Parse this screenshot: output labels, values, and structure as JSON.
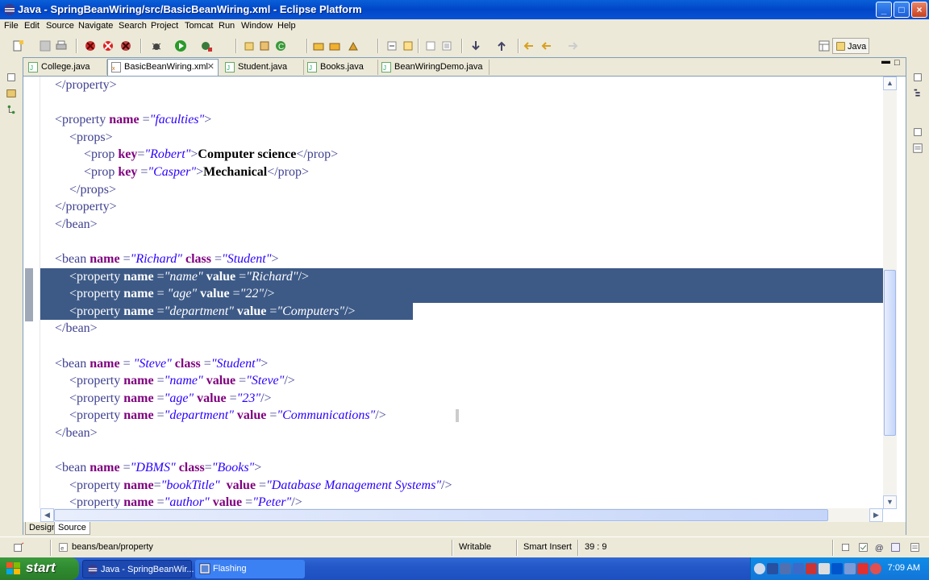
{
  "window": {
    "title": "Java - SpringBeanWiring/src/BasicBeanWiring.xml - Eclipse Platform",
    "controls": {
      "minimize": "_",
      "maximize": "□",
      "close": "×"
    }
  },
  "menu": [
    "File",
    "Edit",
    "Source",
    "Navigate",
    "Search",
    "Project",
    "Tomcat",
    "Run",
    "Window",
    "Help"
  ],
  "perspective": {
    "label": "Java"
  },
  "tabs": [
    {
      "label": "College.java",
      "active": false
    },
    {
      "label": "BasicBeanWiring.xml",
      "active": true
    },
    {
      "label": "Student.java",
      "active": false
    },
    {
      "label": "Books.java",
      "active": false
    },
    {
      "label": "BeanWiringDemo.java",
      "active": false
    }
  ],
  "code_lines": [
    {
      "indent": 1,
      "selected": false,
      "tokens": [
        [
          "tag",
          "</property>"
        ]
      ]
    },
    {
      "indent": 0,
      "selected": false,
      "tokens": []
    },
    {
      "indent": 1,
      "selected": false,
      "tokens": [
        [
          "tag",
          "<property "
        ],
        [
          "attr",
          "name "
        ],
        [
          "tag",
          "="
        ],
        [
          "val",
          "\"faculties\""
        ],
        [
          "tag",
          ">"
        ]
      ]
    },
    {
      "indent": 2,
      "selected": false,
      "tokens": [
        [
          "tag",
          "<props>"
        ]
      ]
    },
    {
      "indent": 3,
      "selected": false,
      "tokens": [
        [
          "tag",
          "<prop "
        ],
        [
          "attr",
          "key"
        ],
        [
          "tag",
          "="
        ],
        [
          "val",
          "\"Robert\""
        ],
        [
          "tag",
          ">"
        ],
        [
          "txt",
          "Computer science"
        ],
        [
          "tag",
          "</prop>"
        ]
      ]
    },
    {
      "indent": 3,
      "selected": false,
      "tokens": [
        [
          "tag",
          "<prop "
        ],
        [
          "attr",
          "key "
        ],
        [
          "tag",
          "="
        ],
        [
          "val",
          "\"Casper\""
        ],
        [
          "tag",
          ">"
        ],
        [
          "txt",
          "Mechanical"
        ],
        [
          "tag",
          "</prop>"
        ]
      ]
    },
    {
      "indent": 2,
      "selected": false,
      "tokens": [
        [
          "tag",
          "</props>"
        ]
      ]
    },
    {
      "indent": 1,
      "selected": false,
      "tokens": [
        [
          "tag",
          "</property>"
        ]
      ]
    },
    {
      "indent": 1,
      "selected": false,
      "tokens": [
        [
          "tag",
          "</bean>"
        ]
      ]
    },
    {
      "indent": 0,
      "selected": false,
      "tokens": []
    },
    {
      "indent": 1,
      "selected": false,
      "tokens": [
        [
          "tag",
          "<bean "
        ],
        [
          "attr",
          "name "
        ],
        [
          "tag",
          "="
        ],
        [
          "val",
          "\"Richard\""
        ],
        [
          "tag",
          " "
        ],
        [
          "attr",
          "class "
        ],
        [
          "tag",
          "="
        ],
        [
          "val",
          "\"Student\""
        ],
        [
          "tag",
          ">"
        ]
      ]
    },
    {
      "indent": 2,
      "selected": true,
      "tokens": [
        [
          "tag",
          "<property "
        ],
        [
          "attr",
          "name "
        ],
        [
          "tag",
          "="
        ],
        [
          "val",
          "\"name\""
        ],
        [
          "tag",
          " "
        ],
        [
          "attr",
          "value "
        ],
        [
          "tag",
          "="
        ],
        [
          "val",
          "\"Richard\""
        ],
        [
          "tag",
          "/>"
        ]
      ]
    },
    {
      "indent": 2,
      "selected": true,
      "tokens": [
        [
          "tag",
          "<property "
        ],
        [
          "attr",
          "name "
        ],
        [
          "tag",
          "= "
        ],
        [
          "val",
          "\"age\""
        ],
        [
          "tag",
          " "
        ],
        [
          "attr",
          "value "
        ],
        [
          "tag",
          "="
        ],
        [
          "val",
          "\"22\""
        ],
        [
          "tag",
          "/>"
        ]
      ]
    },
    {
      "indent": 2,
      "selected": true,
      "tokens": [
        [
          "tag",
          "<property "
        ],
        [
          "attr",
          "name "
        ],
        [
          "tag",
          "="
        ],
        [
          "val",
          "\"department\""
        ],
        [
          "tag",
          " "
        ],
        [
          "attr",
          "value "
        ],
        [
          "tag",
          "="
        ],
        [
          "val",
          "\"Computers\""
        ],
        [
          "tag",
          "/>"
        ]
      ]
    },
    {
      "indent": 1,
      "selected": false,
      "tokens": [
        [
          "tag",
          "</bean>"
        ]
      ]
    },
    {
      "indent": 0,
      "selected": false,
      "tokens": []
    },
    {
      "indent": 1,
      "selected": false,
      "tokens": [
        [
          "tag",
          "<bean "
        ],
        [
          "attr",
          "name "
        ],
        [
          "tag",
          "= "
        ],
        [
          "val",
          "\"Steve\""
        ],
        [
          "tag",
          " "
        ],
        [
          "attr",
          "class "
        ],
        [
          "tag",
          "="
        ],
        [
          "val",
          "\"Student\""
        ],
        [
          "tag",
          ">"
        ]
      ]
    },
    {
      "indent": 2,
      "selected": false,
      "tokens": [
        [
          "tag",
          "<property "
        ],
        [
          "attr",
          "name "
        ],
        [
          "tag",
          "="
        ],
        [
          "val",
          "\"name\""
        ],
        [
          "tag",
          " "
        ],
        [
          "attr",
          "value "
        ],
        [
          "tag",
          "="
        ],
        [
          "val",
          "\"Steve\""
        ],
        [
          "tag",
          "/>"
        ]
      ]
    },
    {
      "indent": 2,
      "selected": false,
      "tokens": [
        [
          "tag",
          "<property "
        ],
        [
          "attr",
          "name "
        ],
        [
          "tag",
          "="
        ],
        [
          "val",
          "\"age\""
        ],
        [
          "tag",
          " "
        ],
        [
          "attr",
          "value "
        ],
        [
          "tag",
          "="
        ],
        [
          "val",
          "\"23\""
        ],
        [
          "tag",
          "/>"
        ]
      ]
    },
    {
      "indent": 2,
      "selected": false,
      "tokens": [
        [
          "tag",
          "<property "
        ],
        [
          "attr",
          "name "
        ],
        [
          "tag",
          "="
        ],
        [
          "val",
          "\"department\""
        ],
        [
          "tag",
          " "
        ],
        [
          "attr",
          "value "
        ],
        [
          "tag",
          "="
        ],
        [
          "val",
          "\"Communications\""
        ],
        [
          "tag",
          "/>"
        ]
      ]
    },
    {
      "indent": 1,
      "selected": false,
      "tokens": [
        [
          "tag",
          "</bean>"
        ]
      ]
    },
    {
      "indent": 0,
      "selected": false,
      "tokens": []
    },
    {
      "indent": 1,
      "selected": false,
      "tokens": [
        [
          "tag",
          "<bean "
        ],
        [
          "attr",
          "name "
        ],
        [
          "tag",
          "="
        ],
        [
          "val",
          "\"DBMS\""
        ],
        [
          "tag",
          " "
        ],
        [
          "attr",
          "class"
        ],
        [
          "tag",
          "="
        ],
        [
          "val",
          "\"Books\""
        ],
        [
          "tag",
          ">"
        ]
      ]
    },
    {
      "indent": 2,
      "selected": false,
      "tokens": [
        [
          "tag",
          "<property "
        ],
        [
          "attr",
          "name"
        ],
        [
          "tag",
          "="
        ],
        [
          "val",
          "\"bookTitle\""
        ],
        [
          "tag",
          "  "
        ],
        [
          "attr",
          "value "
        ],
        [
          "tag",
          "="
        ],
        [
          "val",
          "\"Database Management Systems\""
        ],
        [
          "tag",
          "/>"
        ]
      ]
    },
    {
      "indent": 2,
      "selected": false,
      "tokens": [
        [
          "tag",
          "<property "
        ],
        [
          "attr",
          "name "
        ],
        [
          "tag",
          "="
        ],
        [
          "val",
          "\"author\""
        ],
        [
          "tag",
          " "
        ],
        [
          "attr",
          "value "
        ],
        [
          "tag",
          "="
        ],
        [
          "val",
          "\"Peter\""
        ],
        [
          "tag",
          "/>"
        ]
      ]
    }
  ],
  "editor_bottom_tabs": [
    {
      "label": "Design",
      "active": false
    },
    {
      "label": "Source",
      "active": true
    }
  ],
  "status": {
    "path": "beans/bean/property",
    "writable": "Writable",
    "insert_mode": "Smart Insert",
    "position": "39 : 9"
  },
  "taskbar": {
    "start_label": "start",
    "tasks": [
      {
        "label": "Java - SpringBeanWir...",
        "active": true
      },
      {
        "label": "Flashing",
        "active": false
      }
    ],
    "clock": "7:09 AM"
  },
  "colors": {
    "selection": "#3d5a87",
    "tag": "#3f4191",
    "attribute": "#7f007f",
    "value": "#2a00ff"
  }
}
